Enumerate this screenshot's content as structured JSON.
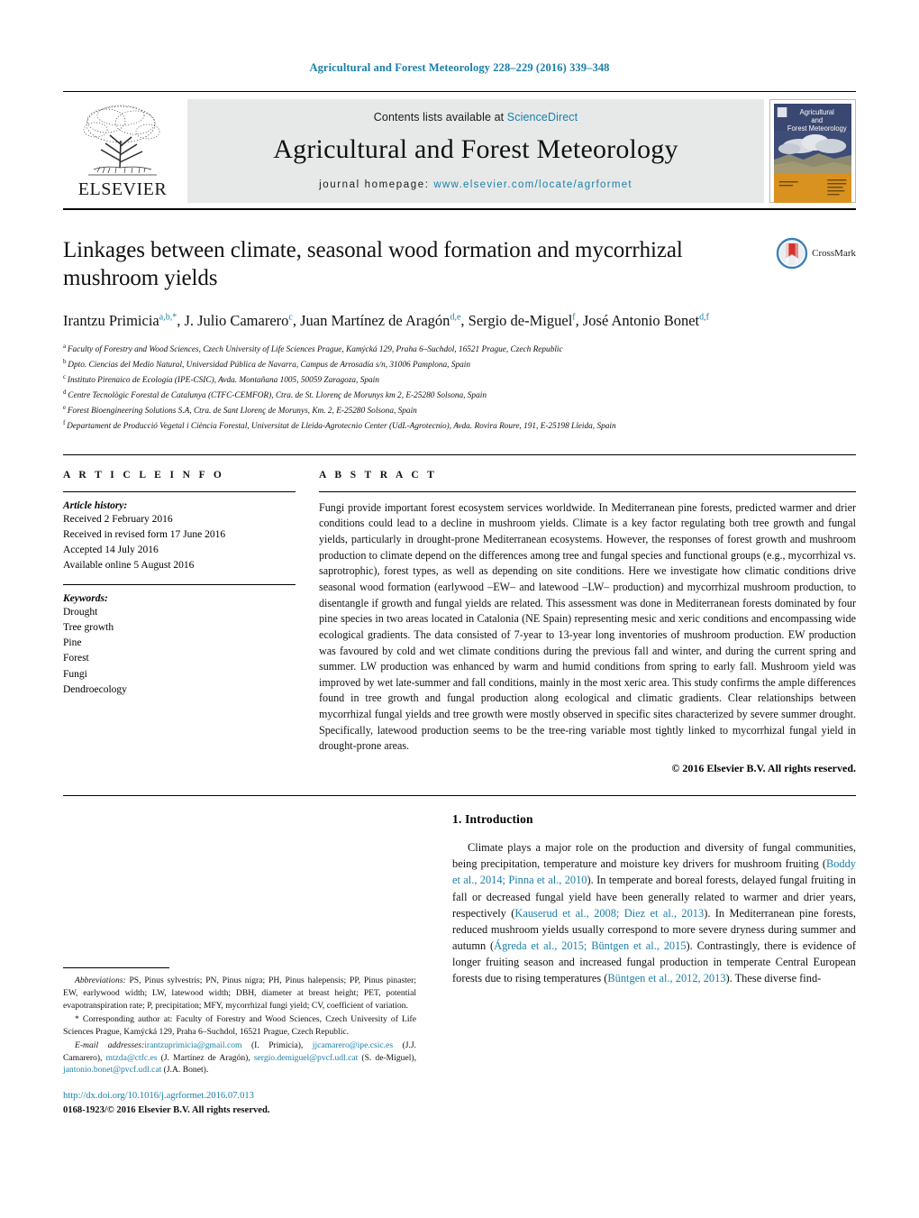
{
  "running_head": "Agricultural and Forest Meteorology 228–229 (2016) 339–348",
  "masthead": {
    "publisher": "ELSEVIER",
    "contents_prefix": "Contents lists available at ",
    "contents_link": "ScienceDirect",
    "journal_name": "Agricultural and Forest Meteorology",
    "homepage_prefix": "journal homepage: ",
    "homepage_url": "www.elsevier.com/locate/agrformet",
    "cover_title_line1": "Agricultural",
    "cover_title_line2": "and",
    "cover_title_line3": "Forest Meteorology"
  },
  "title": "Linkages between climate, seasonal wood formation and mycorrhizal mushroom yields",
  "crossmark_label": "CrossMark",
  "authors": [
    {
      "name": "Irantzu Primicia",
      "marks": "a,b,",
      "star": true,
      "sep": ", "
    },
    {
      "name": "J. Julio Camarero",
      "marks": "c",
      "star": false,
      "sep": ", "
    },
    {
      "name": "Juan Martínez de Aragón",
      "marks": "d,e",
      "star": false,
      "sep": ", "
    },
    {
      "name": "Sergio de-Miguel",
      "marks": "f",
      "star": false,
      "sep": ", "
    },
    {
      "name": "José Antonio Bonet",
      "marks": "d,f",
      "star": false,
      "sep": ""
    }
  ],
  "affiliations": [
    {
      "mark": "a",
      "text": "Faculty of Forestry and Wood Sciences, Czech University of Life Sciences Prague, Kamýcká 129, Praha 6–Suchdol, 16521 Prague, Czech Republic"
    },
    {
      "mark": "b",
      "text": "Dpto. Ciencias del Medio Natural, Universidad Pública de Navarra, Campus de Arrosadía s/n, 31006 Pamplona, Spain"
    },
    {
      "mark": "c",
      "text": "Instituto Pirenaico de Ecología (IPE-CSIC), Avda. Montañana 1005, 50059 Zaragoza, Spain"
    },
    {
      "mark": "d",
      "text": "Centre Tecnològic Forestal de Catalunya (CTFC-CEMFOR), Ctra. de St. Llorenç de Morunys km 2, E-25280 Solsona, Spain"
    },
    {
      "mark": "e",
      "text": "Forest Bioengineering Solutions S.A, Ctra. de Sant Llorenç de Morunys, Km. 2, E-25280 Solsona, Spain"
    },
    {
      "mark": "f",
      "text": "Departament de Producció Vegetal i Ciència Forestal, Universitat de Lleida-Agrotecnio Center (UdL-Agrotecnio), Avda. Rovira Roure, 191, E-25198 Lleida, Spain"
    }
  ],
  "article_info": {
    "heading": "A R T I C L E   I N F O",
    "history_label": "Article history:",
    "history": [
      "Received 2 February 2016",
      "Received in revised form 17 June 2016",
      "Accepted 14 July 2016",
      "Available online 5 August 2016"
    ],
    "keywords_label": "Keywords:",
    "keywords": [
      "Drought",
      "Tree growth",
      "Pine",
      "Forest",
      "Fungi",
      "Dendroecology"
    ]
  },
  "abstract": {
    "heading": "A B S T R A C T",
    "text": "Fungi provide important forest ecosystem services worldwide. In Mediterranean pine forests, predicted warmer and drier conditions could lead to a decline in mushroom yields. Climate is a key factor regulating both tree growth and fungal yields, particularly in drought-prone Mediterranean ecosystems. However, the responses of forest growth and mushroom production to climate depend on the differences among tree and fungal species and functional groups (e.g., mycorrhizal vs. saprotrophic), forest types, as well as depending on site conditions. Here we investigate how climatic conditions drive seasonal wood formation (earlywood –EW– and latewood –LW– production) and mycorrhizal mushroom production, to disentangle if growth and fungal yields are related. This assessment was done in Mediterranean forests dominated by four pine species in two areas located in Catalonia (NE Spain) representing mesic and xeric conditions and encompassing wide ecological gradients. The data consisted of 7-year to 13-year long inventories of mushroom production. EW production was favoured by cold and wet climate conditions during the previous fall and winter, and during the current spring and summer. LW production was enhanced by warm and humid conditions from spring to early fall. Mushroom yield was improved by wet late-summer and fall conditions, mainly in the most xeric area. This study confirms the ample differences found in tree growth and fungal production along ecological and climatic gradients. Clear relationships between mycorrhizal fungal yields and tree growth were mostly observed in specific sites characterized by severe summer drought. Specifically, latewood production seems to be the tree-ring variable most tightly linked to mycorrhizal fungal yield in drought-prone areas.",
    "copyright": "© 2016 Elsevier B.V. All rights reserved."
  },
  "footnotes": {
    "abbreviations_label": "Abbreviations:",
    "abbreviations_text": " PS, Pinus sylvestris; PN, Pinus nigra; PH, Pinus halepensis; PP, Pinus pinaster; EW, earlywood width; LW, latewood width; DBH, diameter at breast height; PET, potential evapotranspiration rate; P, precipitation; MFY, mycorrhizal fungi yield; CV, coefficient of variation.",
    "corresponding_text": "* Corresponding author at: Faculty of Forestry and Wood Sciences, Czech University of Life Sciences Prague, Kamýcká 129, Praha 6–Suchdol, 16521 Prague, Czech Republic.",
    "email_label": "E-mail addresses:",
    "emails": [
      {
        "address": "irantzuprimicia@gmail.com",
        "owner": " (I. Primicia),"
      },
      {
        "address": "jjcamarero@ipe.csic.es",
        "owner": " (J.J. Camarero),"
      },
      {
        "address": "mtzda@ctfc.es",
        "owner": " (J. Martínez de Aragón),"
      },
      {
        "address": "sergio.demiguel@pvcf.udl.cat",
        "owner": " (S. de-Miguel),"
      },
      {
        "address": "jantonio.bonet@pvcf.udl.cat",
        "owner": " (J.A. Bonet)."
      }
    ]
  },
  "doi_block": {
    "doi": "http://dx.doi.org/10.1016/j.agrformet.2016.07.013",
    "issn": "0168-1923/© 2016 Elsevier B.V. All rights reserved."
  },
  "introduction": {
    "heading": "1.  Introduction",
    "paragraph_parts": [
      {
        "t": "Climate plays a major role on the production and diversity of fungal communities, being precipitation, temperature and moisture key drivers for mushroom fruiting (",
        "ref": false
      },
      {
        "t": "Boddy et al., 2014; Pinna et al., 2010",
        "ref": true
      },
      {
        "t": "). In temperate and boreal forests, delayed fungal fruiting in fall or decreased fungal yield have been generally related to warmer and drier years, respectively (",
        "ref": false
      },
      {
        "t": "Kauserud et al., 2008; Diez et al., 2013",
        "ref": true
      },
      {
        "t": "). In Mediterranean pine forests, reduced mushroom yields usually correspond to more severe dryness during summer and autumn (",
        "ref": false
      },
      {
        "t": "Ágreda et al., 2015; Büntgen et al., 2015",
        "ref": true
      },
      {
        "t": "). Contrastingly, there is evidence of longer fruiting season and increased fungal production in temperate Central European forests due to rising temperatures (",
        "ref": false
      },
      {
        "t": "Büntgen et al., 2012, 2013",
        "ref": true
      },
      {
        "t": "). These diverse find-",
        "ref": false
      }
    ]
  },
  "colors": {
    "link": "#1a7fa8",
    "elsevier_orange": "#e87422",
    "band_grey": "#e7e9e9"
  }
}
